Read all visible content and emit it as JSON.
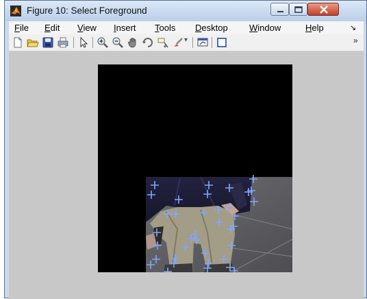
{
  "window": {
    "title": "Figure 10: Select Foreground",
    "buttons": {
      "minimize": "minimize",
      "maximize": "maximize",
      "close": "close"
    }
  },
  "menubar": {
    "items": [
      {
        "label": "File",
        "underline_index": 0
      },
      {
        "label": "Edit",
        "underline_index": 0
      },
      {
        "label": "View",
        "underline_index": 0
      },
      {
        "label": "Insert",
        "underline_index": 0
      },
      {
        "label": "Tools",
        "underline_index": 0
      },
      {
        "label": "Desktop",
        "underline_index": 0
      },
      {
        "label": "Window",
        "underline_index": 0
      },
      {
        "label": "Help",
        "underline_index": 0
      }
    ],
    "overflow": "↘"
  },
  "toolbar": {
    "icons": [
      "new-figure-icon",
      "open-file-icon",
      "save-icon",
      "print-icon",
      "edit-plot-arrow-icon",
      "zoom-in-icon",
      "zoom-out-icon",
      "pan-hand-icon",
      "rotate-3d-icon",
      "data-cursor-icon",
      "brush-icon",
      "brush-dropdown-icon",
      "link-plot-icon",
      "insert-colorbar-icon"
    ],
    "overflow": "»"
  },
  "figure": {
    "image_content": "masked pedestrian legs photo",
    "marker_color": "#7fa8ff",
    "marker_symbol": "+"
  },
  "colors": {
    "titlebar": "#c9d9ee",
    "client_bg": "#c8c8c8",
    "mask": "#000000"
  }
}
